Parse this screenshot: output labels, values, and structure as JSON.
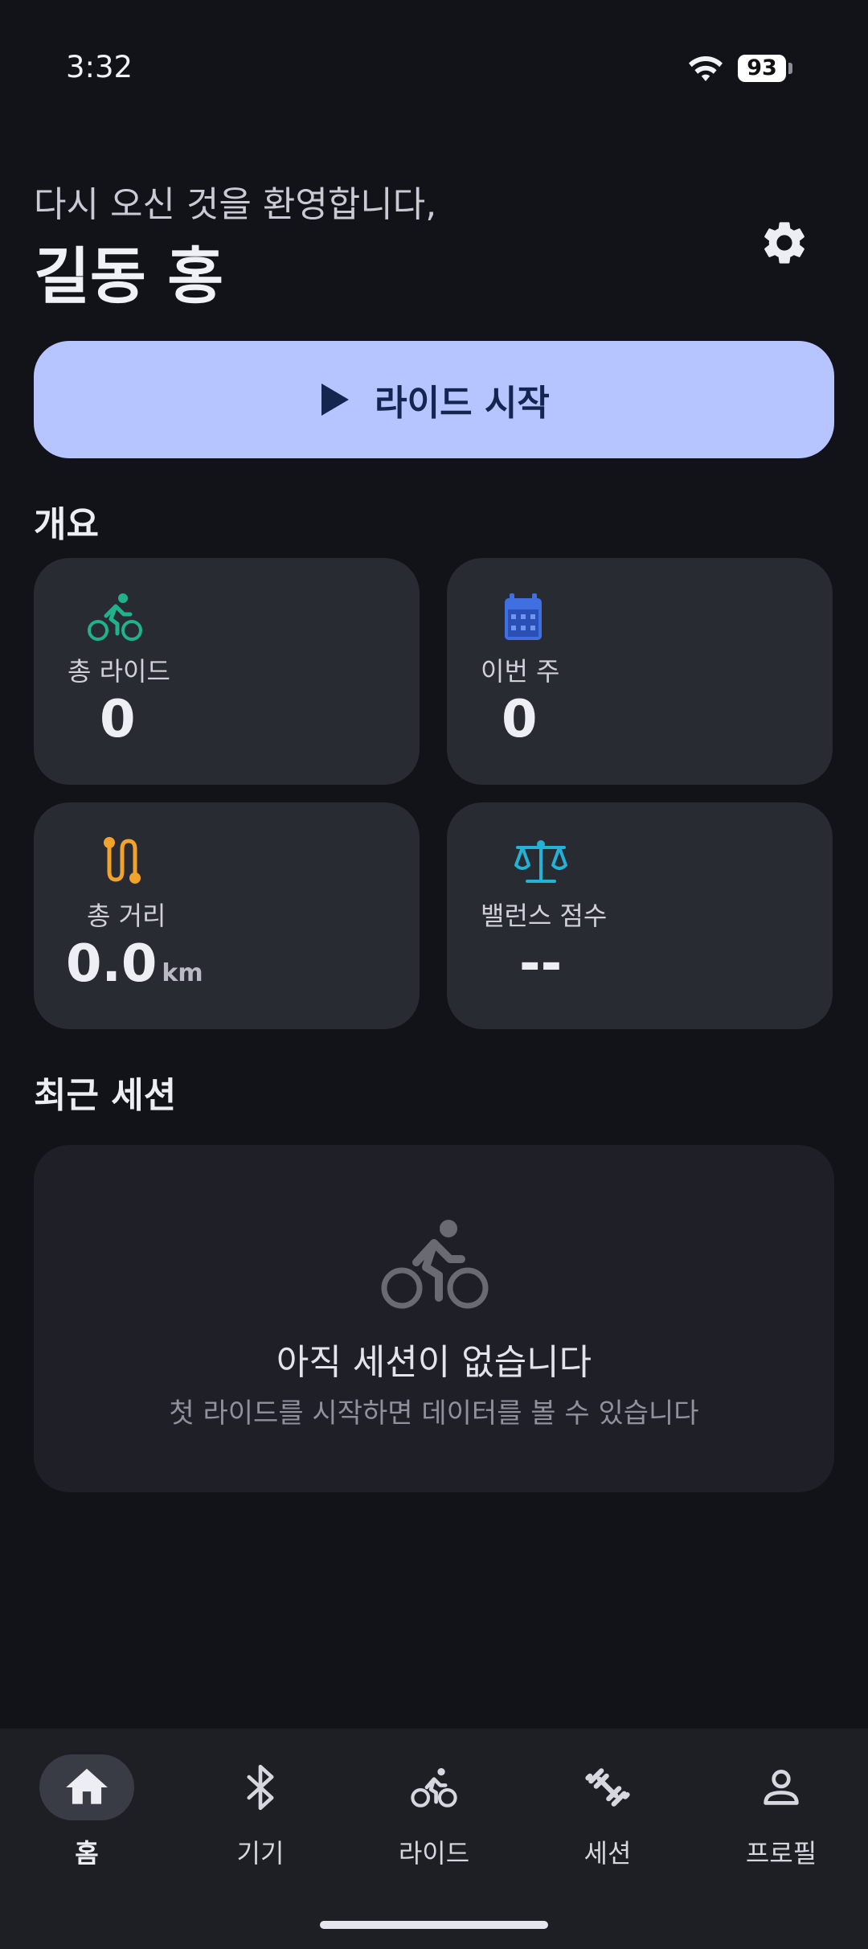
{
  "status_bar": {
    "time": "3:32",
    "battery_level": "93"
  },
  "header": {
    "welcome": "다시 오신 것을 환영합니다,",
    "username": "길동 홍"
  },
  "start_button": {
    "label": "라이드 시작"
  },
  "overview": {
    "title": "개요",
    "cards": [
      {
        "icon": "bike-icon",
        "label": "총 라이드",
        "value": "0",
        "color": "#1fb28b"
      },
      {
        "icon": "calendar-icon",
        "label": "이번 주",
        "value": "0",
        "color": "#3f6fe0"
      },
      {
        "icon": "route-icon",
        "label": "총 거리",
        "value": "0.0",
        "unit": "km",
        "color": "#f2a32b"
      },
      {
        "icon": "balance-scale-icon",
        "label": "밸런스 점수",
        "value": "--",
        "color": "#22b3d6"
      }
    ]
  },
  "recent_sessions": {
    "title": "최근 세션",
    "empty_title": "아직 세션이 없습니다",
    "empty_subtitle": "첫 라이드를 시작하면 데이터를 볼 수 있습니다"
  },
  "bottom_nav": {
    "items": [
      {
        "label": "홈",
        "icon": "home-icon",
        "active": true
      },
      {
        "label": "기기",
        "icon": "bluetooth-icon",
        "active": false
      },
      {
        "label": "라이드",
        "icon": "bike-icon",
        "active": false
      },
      {
        "label": "세션",
        "icon": "dumbbell-icon",
        "active": false
      },
      {
        "label": "프로필",
        "icon": "person-icon",
        "active": false
      }
    ]
  },
  "colors": {
    "background": "#121318",
    "accent": "#b6c4ff",
    "card": "#292b33"
  }
}
